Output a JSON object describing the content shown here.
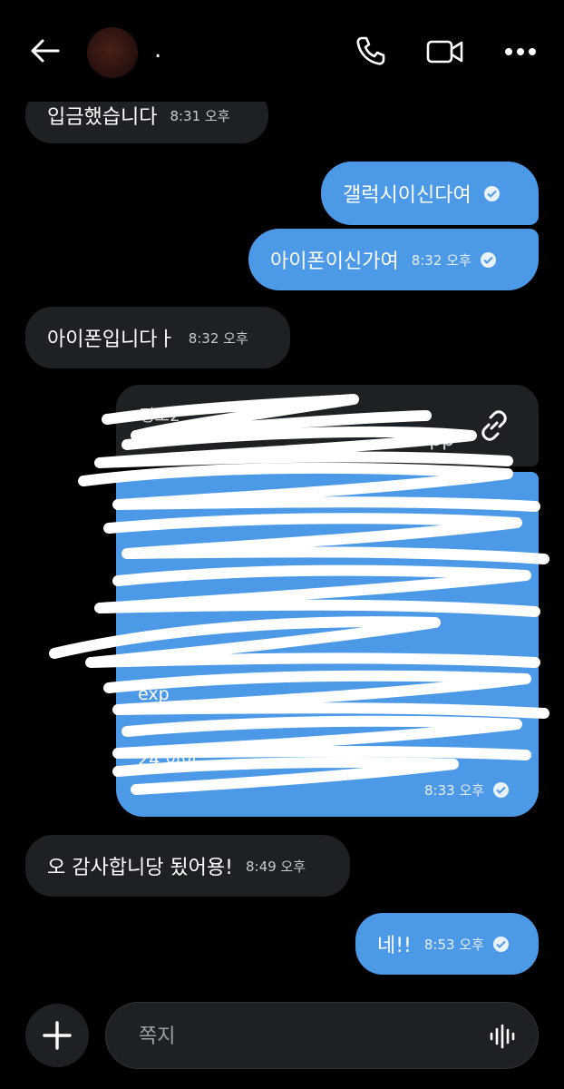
{
  "header": {
    "contact_name": "."
  },
  "messages": [
    {
      "text": "입금했습니다",
      "time": "8:31 오후",
      "dir": "in"
    },
    {
      "text": "갤럭시이신다여",
      "time": "",
      "dir": "out"
    },
    {
      "text": "아이폰이신가여",
      "time": "8:32 오후",
      "dir": "out"
    },
    {
      "text": "아이폰입니다ㅏ",
      "time": "8:32 오후",
      "dir": "in"
    },
    {
      "text": "네!!",
      "time": "8:53 오후",
      "dir": "out"
    },
    {
      "text": "오 감사합니당 됬어용!",
      "time": "8:49 오후",
      "dir": "in"
    }
  ],
  "link_card": {
    "url_fragment": "it.app",
    "title_fragment": "정보2"
  },
  "redacted_message": {
    "time": "8:33 오후",
    "visible_fragments": [
      "exp",
      "24 이이"
    ]
  },
  "composer": {
    "placeholder": "쪽지"
  },
  "colors": {
    "outgoing": "#4c99e7",
    "incoming": "#1e2124",
    "background": "#000000"
  }
}
